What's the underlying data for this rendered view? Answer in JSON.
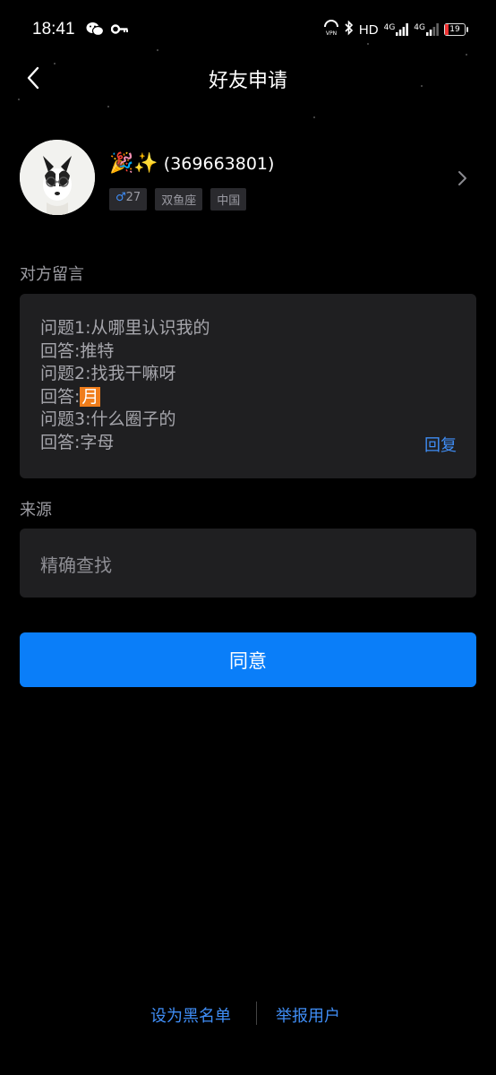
{
  "status_bar": {
    "time": "18:41",
    "network_text": "HD",
    "signal_1": "4G",
    "signal_2": "4G",
    "battery": "19",
    "icons": [
      "wechat-icon",
      "key-icon",
      "vpn-icon",
      "bluetooth-icon",
      "signal-icon",
      "battery-icon"
    ]
  },
  "nav": {
    "title": "好友申请"
  },
  "profile": {
    "emojis": "🎉✨",
    "id_text": "(369663801)",
    "tags": [
      {
        "symbol": "♂",
        "text": "27"
      },
      {
        "symbol": "",
        "text": "双鱼座"
      },
      {
        "symbol": "",
        "text": "中国"
      }
    ]
  },
  "message": {
    "label": "对方留言",
    "lines": [
      {
        "text": "问题1:从哪里认识我的"
      },
      {
        "text": "回答:推特"
      },
      {
        "text": "问题2:找我干嘛呀"
      },
      {
        "prefix": "回答:",
        "highlight": "月"
      },
      {
        "text": "问题3:什么圈子的"
      },
      {
        "text": "回答:字母"
      }
    ],
    "reply_label": "回复"
  },
  "source": {
    "label": "来源",
    "value": "精确查找"
  },
  "agree_label": "同意",
  "footer": {
    "blacklist_label": "设为黑名单",
    "report_label": "举报用户"
  },
  "colors": {
    "accent": "#0a7ef9",
    "link": "#3f8df5",
    "highlight": "#f07d1b",
    "card": "#1f1f21"
  }
}
